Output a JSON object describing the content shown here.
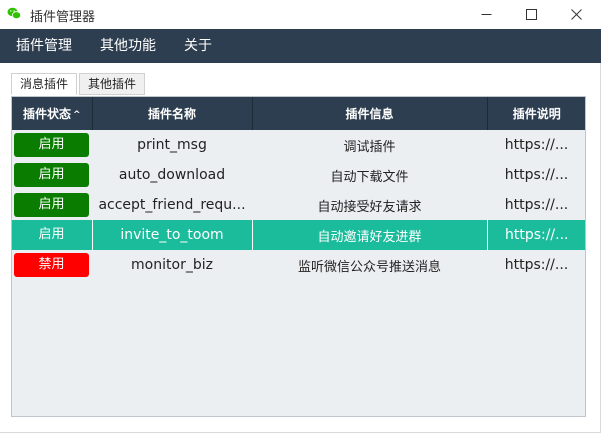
{
  "window": {
    "title": "插件管理器",
    "minimize_icon": "minimize-icon",
    "maximize_icon": "maximize-icon",
    "close_icon": "close-icon"
  },
  "menu": [
    "插件管理",
    "其他功能",
    "关于"
  ],
  "tabs": [
    {
      "label": "消息插件",
      "active": true
    },
    {
      "label": "其他插件",
      "active": false
    }
  ],
  "table": {
    "columns": [
      "插件状态",
      "插件名称",
      "插件信息",
      "插件说明"
    ],
    "sort_indicator": "^",
    "rows": [
      {
        "status": "启用",
        "enabled": true,
        "name": "print_msg",
        "info": "调试插件",
        "desc": "https://...",
        "selected": false
      },
      {
        "status": "启用",
        "enabled": true,
        "name": "auto_download",
        "info": "自动下载文件",
        "desc": "https://...",
        "selected": false
      },
      {
        "status": "启用",
        "enabled": true,
        "name": "accept_friend_requ...",
        "info": "自动接受好友请求",
        "desc": "https://...",
        "selected": false
      },
      {
        "status": "启用",
        "enabled": true,
        "name": "invite_to_toom",
        "info": "自动邀请好友进群",
        "desc": "https://...",
        "selected": true
      },
      {
        "status": "禁用",
        "enabled": false,
        "name": "monitor_biz",
        "info": "监听微信公众号推送消息",
        "desc": "https://...",
        "selected": false
      }
    ]
  },
  "colors": {
    "menubar": "#2d3e50",
    "enabled": "#0a7d00",
    "disabled": "#ff0000",
    "selected_row": "#1abc9c"
  }
}
